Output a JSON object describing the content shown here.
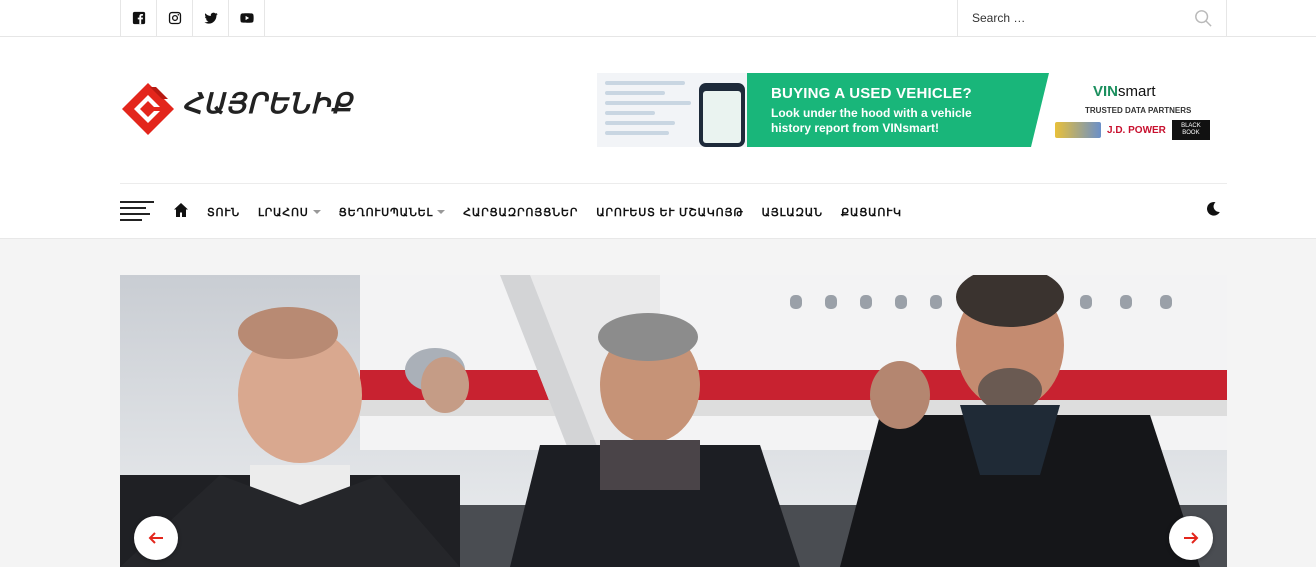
{
  "topbar": {
    "social": [
      {
        "name": "facebook-icon"
      },
      {
        "name": "instagram-icon"
      },
      {
        "name": "twitter-icon"
      },
      {
        "name": "youtube-icon"
      }
    ],
    "search_placeholder": "Search …"
  },
  "brand": {
    "logo_text": "ՀԱՅՐԵՆԻՔ",
    "logo_color": "#e3261c"
  },
  "ad": {
    "headline": "BUYING A USED VEHICLE?",
    "subtext": "Look under the hood with a vehicle history report from VINsmart!",
    "vin_brand_a": "VIN",
    "vin_brand_b": "smart",
    "partners_label": "TRUSTED DATA PARTNERS",
    "jd_power": "J.D. POWER",
    "black_book": "BLACK BOOK",
    "accent_color": "#19b67a"
  },
  "nav": {
    "items": [
      {
        "label": "ՏՈՒՆ",
        "dropdown": false
      },
      {
        "label": "ԼՐԱՀՈՍ",
        "dropdown": true
      },
      {
        "label": "ՑԵՂՈՒՍՊԱՆԵԼ",
        "dropdown": true
      },
      {
        "label": "ՀԱՐՑԱԶՐՈՅՑՆԵՐ",
        "dropdown": false
      },
      {
        "label": "ԱՐՈՒԵՍՏ ԵՒ ՄՇԱԿՈՅԹ",
        "dropdown": false
      },
      {
        "label": "ԱՅԼԱԶԱՆ",
        "dropdown": false
      },
      {
        "label": "ՔԱՑԱՈՒԿ",
        "dropdown": false
      }
    ]
  },
  "slider": {
    "accent_color": "#e3261c"
  }
}
